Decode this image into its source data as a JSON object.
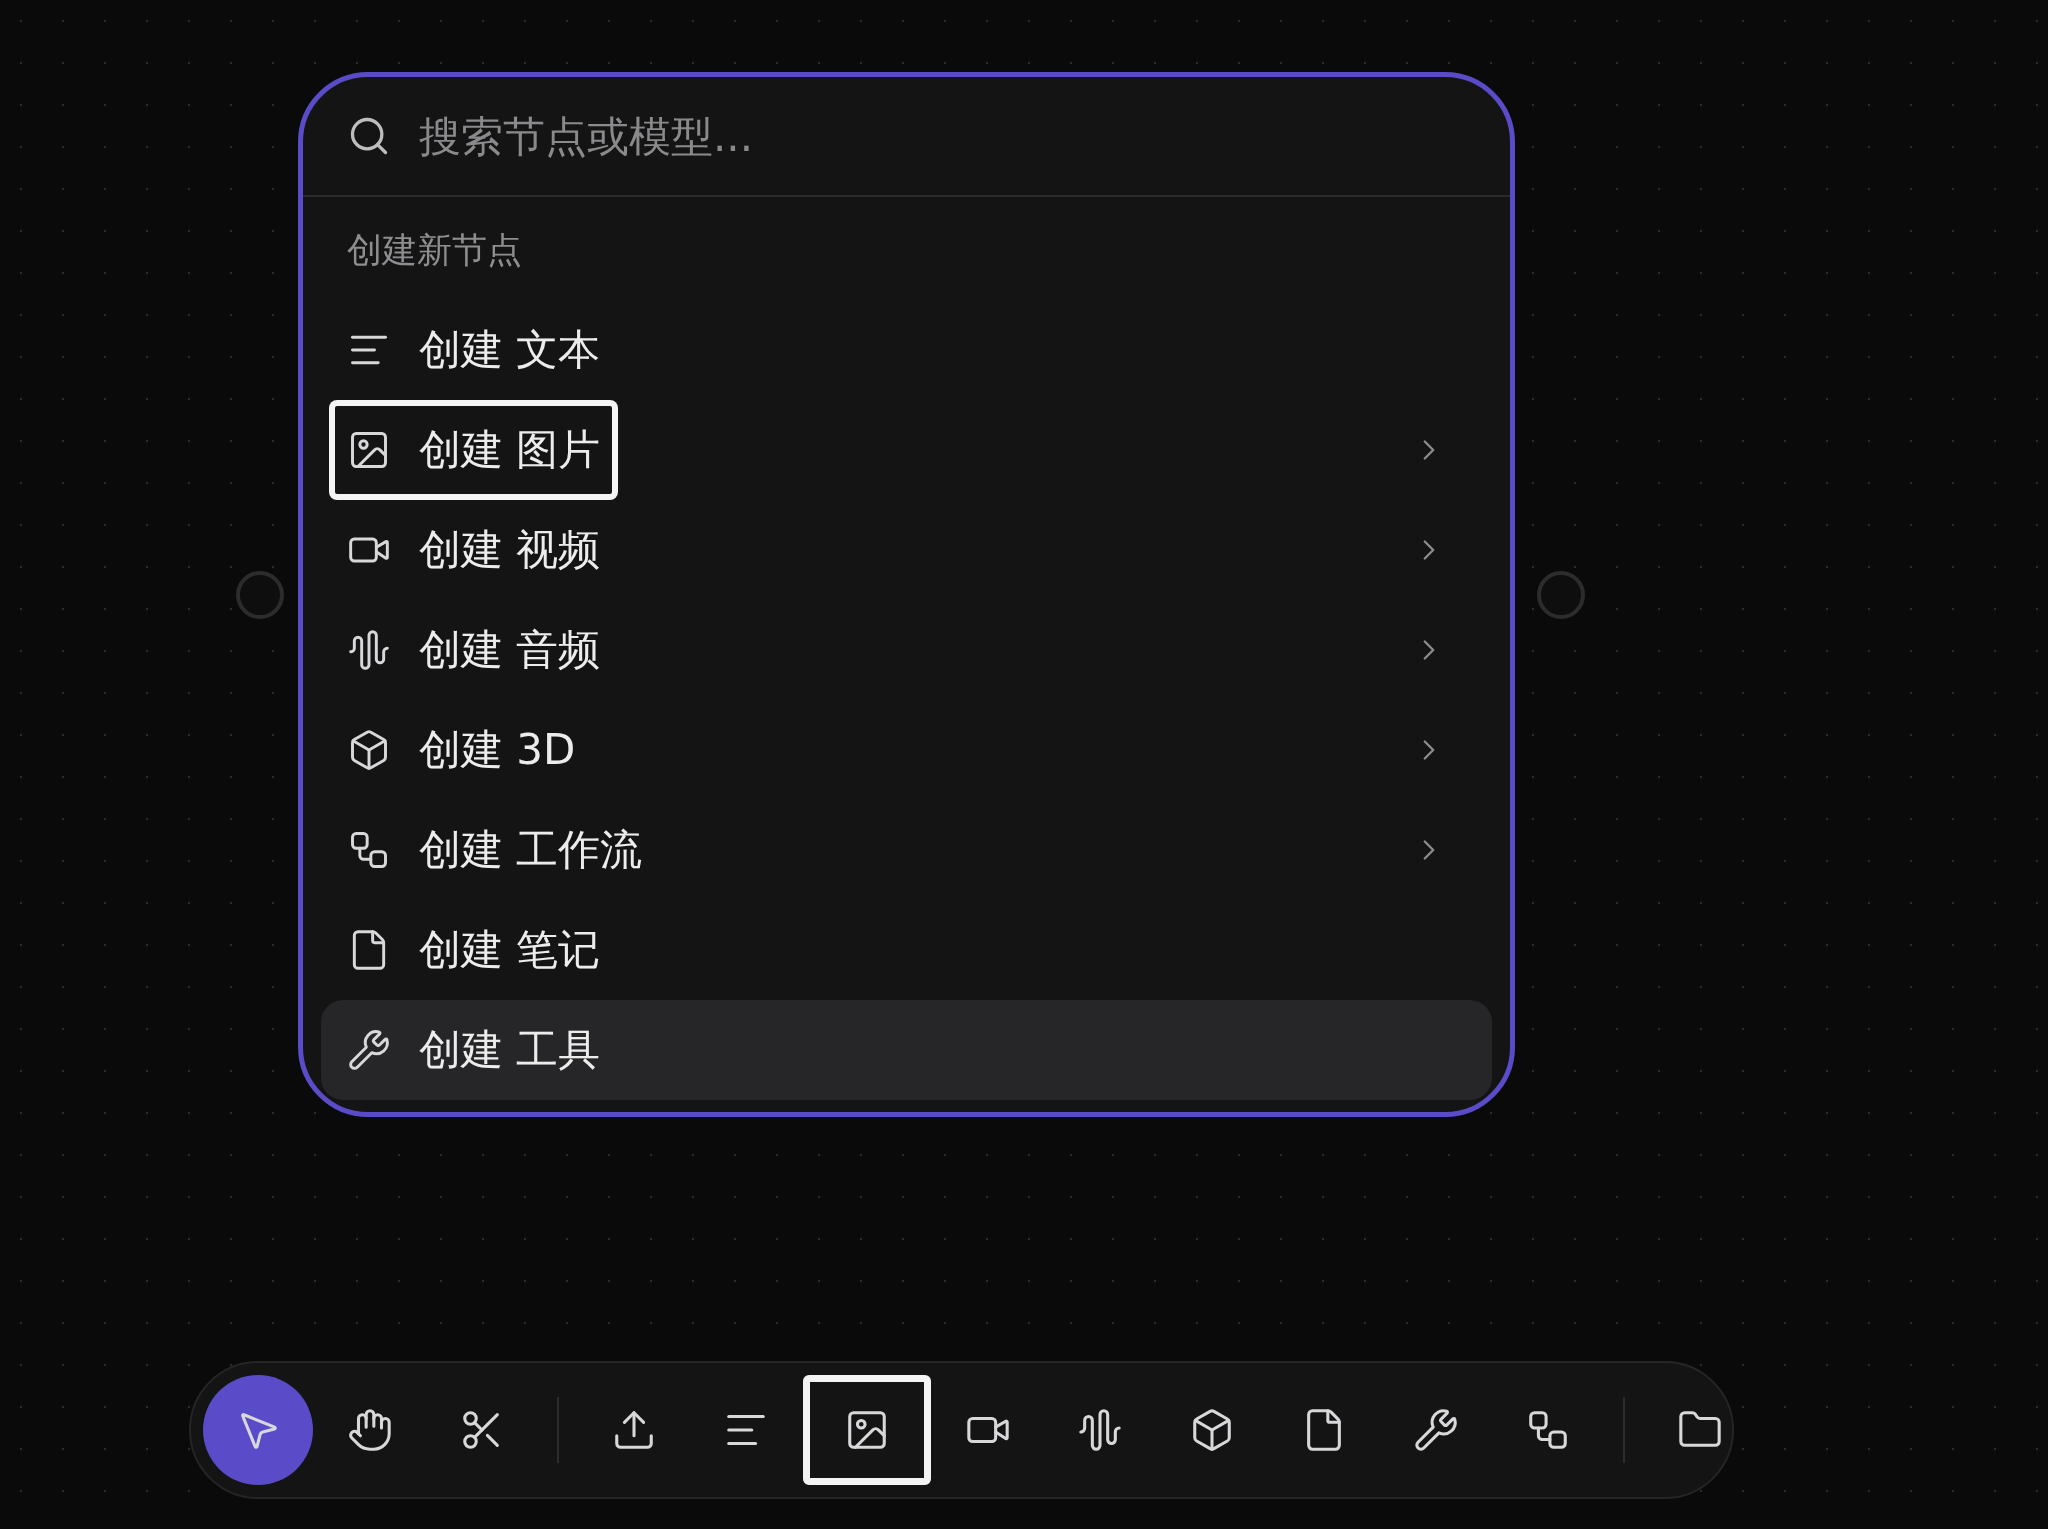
{
  "menu": {
    "search": {
      "placeholder": "搜索节点或模型..."
    },
    "section_label": "创建新节点",
    "items": [
      {
        "kind": "text",
        "label": "创建 文本",
        "has_submenu": false,
        "focused": false,
        "hovered": false
      },
      {
        "kind": "image",
        "label": "创建 图片",
        "has_submenu": true,
        "focused": true,
        "hovered": false
      },
      {
        "kind": "video",
        "label": "创建 视频",
        "has_submenu": true,
        "focused": false,
        "hovered": false
      },
      {
        "kind": "audio",
        "label": "创建 音频",
        "has_submenu": true,
        "focused": false,
        "hovered": false
      },
      {
        "kind": "cube",
        "label": "创建 3D",
        "has_submenu": true,
        "focused": false,
        "hovered": false
      },
      {
        "kind": "workflow",
        "label": "创建 工作流",
        "has_submenu": true,
        "focused": false,
        "hovered": false
      },
      {
        "kind": "note",
        "label": "创建 笔记",
        "has_submenu": false,
        "focused": false,
        "hovered": false
      },
      {
        "kind": "tool",
        "label": "创建 工具",
        "has_submenu": false,
        "focused": false,
        "hovered": true
      }
    ]
  },
  "toolbar": [
    {
      "kind": "select",
      "selected": true,
      "focused": false
    },
    {
      "kind": "hand",
      "selected": false,
      "focused": false
    },
    {
      "kind": "scissors",
      "selected": false,
      "focused": false
    },
    {
      "kind": "separator"
    },
    {
      "kind": "upload",
      "selected": false,
      "focused": false
    },
    {
      "kind": "text",
      "selected": false,
      "focused": false
    },
    {
      "kind": "image",
      "selected": false,
      "focused": true
    },
    {
      "kind": "video",
      "selected": false,
      "focused": false
    },
    {
      "kind": "audio",
      "selected": false,
      "focused": false
    },
    {
      "kind": "cube",
      "selected": false,
      "focused": false
    },
    {
      "kind": "note",
      "selected": false,
      "focused": false
    },
    {
      "kind": "tool",
      "selected": false,
      "focused": false
    },
    {
      "kind": "workflow",
      "selected": false,
      "focused": false
    },
    {
      "kind": "separator"
    },
    {
      "kind": "folder",
      "selected": false,
      "focused": false
    }
  ]
}
